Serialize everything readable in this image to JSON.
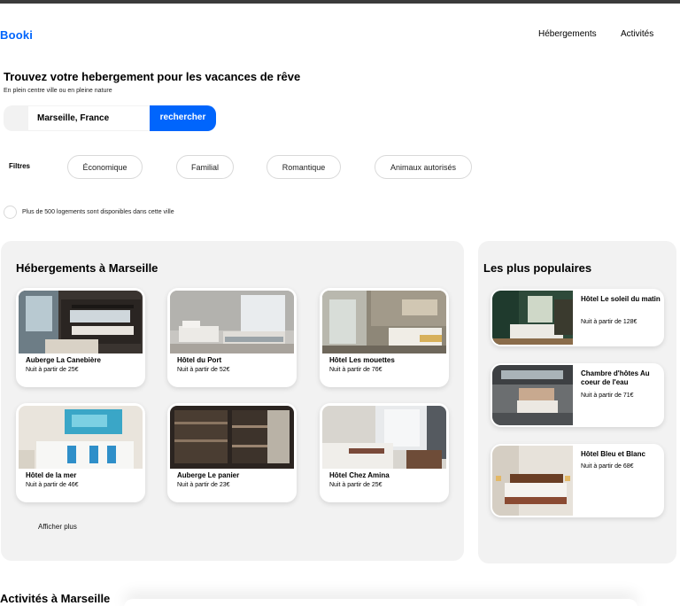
{
  "header": {
    "logo": "Booki",
    "nav": [
      "Hébergements",
      "Activités"
    ]
  },
  "hero": {
    "title": "Trouvez votre hebergement pour les vacances de rêve",
    "subtitle": "En plein centre ville ou en pleine nature",
    "search_value": "Marseille, France",
    "search_button": "rechercher"
  },
  "filters": {
    "label": "Filtres",
    "chips": [
      "Économique",
      "Familial",
      "Romantique",
      "Animaux autorisés"
    ]
  },
  "info": "Plus de 500 logements sont disponibles dans cette ville",
  "hebergements": {
    "title": "Hébergements à Marseille",
    "cards": [
      {
        "name": "Auberge La Canebière",
        "price": "Nuit à partir de 25€"
      },
      {
        "name": "Hôtel du Port",
        "price": "Nuit à partir de 52€"
      },
      {
        "name": "Hôtel Les mouettes",
        "price": "Nuit à partir de 76€"
      },
      {
        "name": "Hôtel de la mer",
        "price": "Nuit à partir de 46€"
      },
      {
        "name": "Auberge Le panier",
        "price": "Nuit à partir de 23€"
      },
      {
        "name": "Hôtel Chez Amina",
        "price": "Nuit à partir de 25€"
      }
    ],
    "more": "Afficher plus"
  },
  "populaires": {
    "title": "Les plus populaires",
    "items": [
      {
        "name": "Hôtel Le soleil du matin",
        "price": "Nuit à partir de 128€"
      },
      {
        "name": "Chambre d'hôtes Au coeur de l'eau",
        "price": "Nuit à partir de 71€"
      },
      {
        "name": "Hôtel Bleu et Blanc",
        "price": "Nuit à partir de 68€"
      }
    ]
  },
  "activites": {
    "title": "Activités à Marseille"
  },
  "colors": {
    "accent": "#0065fc",
    "panel": "#f2f2f2"
  }
}
